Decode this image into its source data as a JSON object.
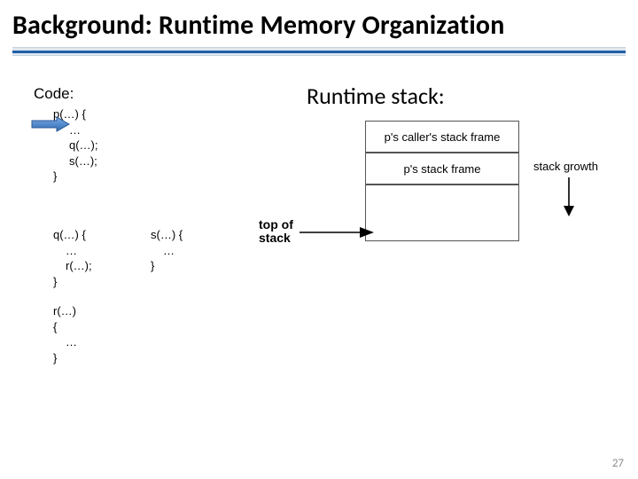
{
  "title": "Background: Runtime Memory Organization",
  "code": {
    "label": "Code:",
    "p": {
      "head": "p(…) {",
      "l1": "…",
      "l2": "q(…);",
      "l3": "s(…);",
      "end": "}"
    },
    "q": {
      "head": "q(…) {",
      "l1": "…",
      "l2": "r(…);",
      "end": "}"
    },
    "s": {
      "head": "s(…) {",
      "l1": "…",
      "end": "}"
    },
    "r": {
      "head": "r(…)",
      "brace": "{",
      "l1": "…",
      "end": "}"
    }
  },
  "runtime": {
    "title": "Runtime stack:",
    "frame_caller": "p's caller's stack frame",
    "frame_p": "p's stack frame",
    "growth": "stack growth",
    "tos1": "top of",
    "tos2": "stack"
  },
  "page": "27"
}
